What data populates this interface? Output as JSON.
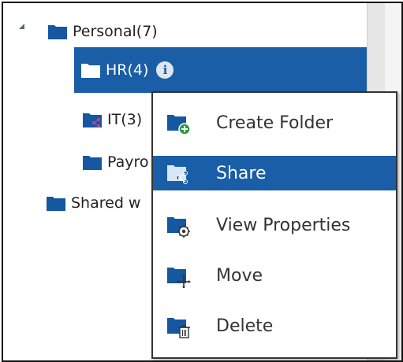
{
  "tree": {
    "nodes": [
      {
        "label": "Personal",
        "count": "(7)"
      },
      {
        "label": "HR",
        "count": "(4)"
      },
      {
        "label": "IT",
        "count": "(3)"
      },
      {
        "label": "Payro",
        "count": ""
      },
      {
        "label": "Shared w",
        "count": ""
      }
    ],
    "info_glyph": "i"
  },
  "context_menu": {
    "items": [
      {
        "label": "Create Folder",
        "icon": "folder-add-icon"
      },
      {
        "label": "Share",
        "icon": "folder-share-icon"
      },
      {
        "label": "View Properties",
        "icon": "folder-settings-icon"
      },
      {
        "label": "Move",
        "icon": "folder-move-icon"
      },
      {
        "label": "Delete",
        "icon": "folder-delete-icon"
      }
    ],
    "active_index": 1
  },
  "colors": {
    "accent": "#1a5ea8",
    "folder": "#1557a0",
    "add": "#2e9a3a"
  }
}
